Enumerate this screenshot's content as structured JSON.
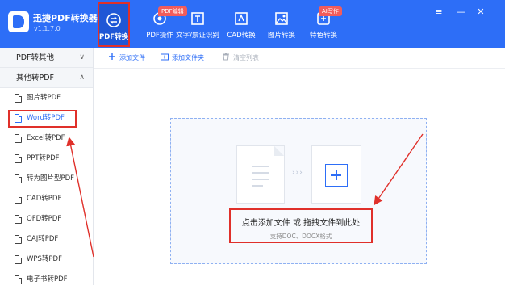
{
  "app": {
    "name": "迅捷PDF转换器",
    "version": "v1.1.7.0"
  },
  "nav": [
    {
      "label": "PDF转换",
      "icon": "convert-icon",
      "active": true
    },
    {
      "label": "PDF操作",
      "icon": "pdf-operation-icon",
      "badge": "PDF编辑"
    },
    {
      "label": "文字/票证识别",
      "icon": "ocr-icon"
    },
    {
      "label": "CAD转换",
      "icon": "cad-icon"
    },
    {
      "label": "图片转换",
      "icon": "image-icon"
    },
    {
      "label": "特色转换",
      "icon": "special-icon",
      "badge": "AI写作"
    }
  ],
  "window_controls": {
    "menu": "≡",
    "minimize": "—",
    "close": "✕"
  },
  "sidebar": {
    "groups": [
      {
        "label": "PDF转其他",
        "chevron": "∨"
      },
      {
        "label": "其他转PDF",
        "chevron": "∧"
      }
    ],
    "items": [
      {
        "label": "图片转PDF"
      },
      {
        "label": "Word转PDF",
        "selected": true
      },
      {
        "label": "Excel转PDF"
      },
      {
        "label": "PPT转PDF"
      },
      {
        "label": "转为图片型PDF"
      },
      {
        "label": "CAD转PDF"
      },
      {
        "label": "OFD转PDF"
      },
      {
        "label": "CAJ转PDF"
      },
      {
        "label": "WPS转PDF"
      },
      {
        "label": "电子书转PDF"
      }
    ]
  },
  "toolbar": {
    "add_file": "添加文件",
    "add_folder": "添加文件夹",
    "clear_list": "清空列表"
  },
  "dropzone": {
    "main_text": "点击添加文件 或 拖拽文件到此处",
    "sub_text": "支持DOC、DOCX格式",
    "arrows": "›››"
  },
  "colors": {
    "brand": "#2d6ef7",
    "annotation": "#e0302a"
  }
}
